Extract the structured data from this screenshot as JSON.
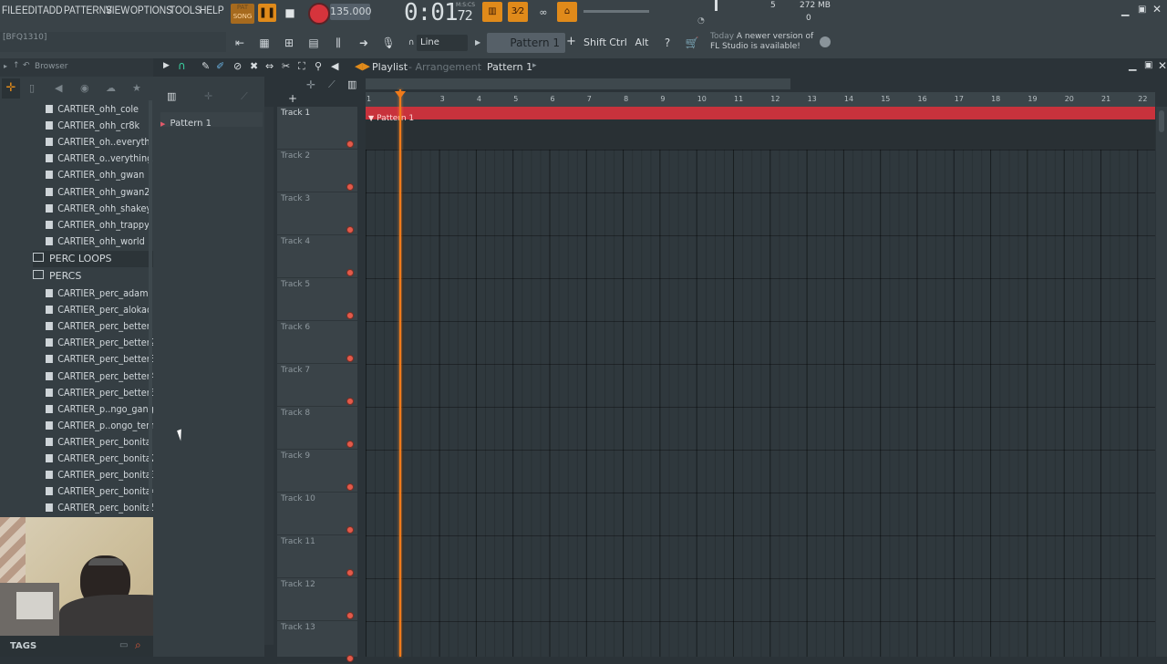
{
  "menu": [
    "FILE",
    "EDIT",
    "ADD",
    "PATTERNS",
    "VIEW",
    "OPTIONS",
    "TOOLS",
    "HELP"
  ],
  "transport": {
    "song_mode": "SONG",
    "pat_label": "PAT",
    "tempo": "135.000",
    "time": "0:01",
    "time_frac": "72",
    "time_unit": "M:S:CS"
  },
  "monitor": {
    "cpu_value": "5",
    "memory": "272 MB",
    "polyphony": "0"
  },
  "hint": "[BFQ1310]",
  "snap": "Line",
  "pattern_selector": "Pattern 1",
  "keys": [
    "Shift",
    "Ctrl",
    "Alt"
  ],
  "news": {
    "date": "Today",
    "line1": "A newer version of",
    "line2": "FL Studio is available!"
  },
  "browser": {
    "title": "Browser",
    "files_top": [
      "CARTIER_ohh_cole",
      "CARTIER_ohh_cr8k",
      "CARTIER_oh..everything",
      "CARTIER_o..verything2",
      "CARTIER_ohh_gwan",
      "CARTIER_ohh_gwan2",
      "CARTIER_ohh_shakey",
      "CARTIER_ohh_trappy",
      "CARTIER_ohh_world"
    ],
    "folders": [
      "PERC LOOPS",
      "PERCS"
    ],
    "files_bottom": [
      "CARTIER_perc_adam",
      "CARTIER_perc_alokao",
      "CARTIER_perc_better",
      "CARTIER_perc_better2",
      "CARTIER_perc_better3",
      "CARTIER_perc_better4",
      "CARTIER_perc_better5",
      "CARTIER_p..ngo_gange",
      "CARTIER_p..ongo_tems",
      "CARTIER_perc_bonita",
      "CARTIER_perc_bonita2",
      "CARTIER_perc_bonita3",
      "CARTIER_perc_bonita4",
      "CARTIER_perc_bonita5"
    ],
    "tags_label": "TAGS"
  },
  "playlist": {
    "title": "Playlist",
    "subtitle": "Arrangement",
    "pattern": "Pattern 1",
    "pattern_list": [
      "Pattern 1"
    ],
    "clip_label": "Pattern 1",
    "ruler": [
      "1",
      "3",
      "4",
      "5",
      "6",
      "7",
      "8",
      "9",
      "10",
      "11",
      "12",
      "13",
      "14",
      "15",
      "16",
      "17",
      "18",
      "19",
      "20",
      "21",
      "22"
    ],
    "tracks": [
      "Track 1",
      "Track 2",
      "Track 3",
      "Track 4",
      "Track 5",
      "Track 6",
      "Track 7",
      "Track 8",
      "Track 9",
      "Track 10",
      "Track 11",
      "Track 12",
      "Track 13"
    ]
  },
  "colors": {
    "accent": "#e08a1a",
    "clip": "#c8323c",
    "playhead": "#f07a1a",
    "background": "#2b3338"
  }
}
